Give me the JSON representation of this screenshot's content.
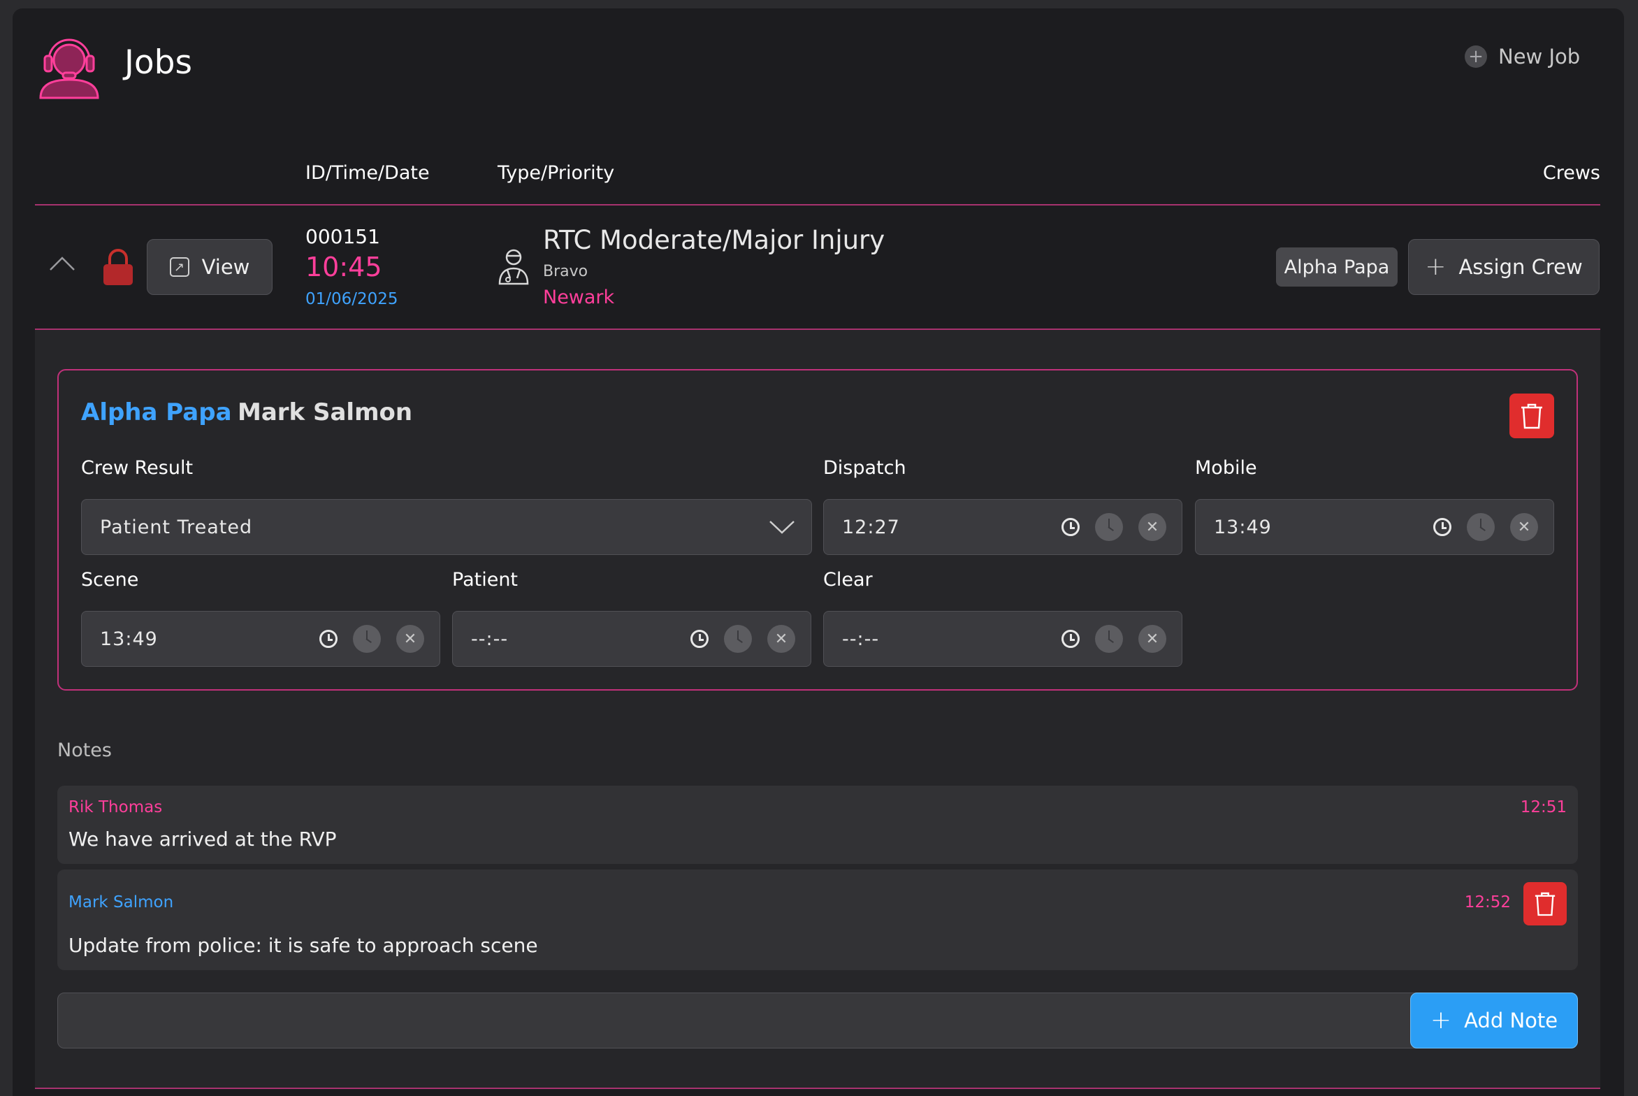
{
  "header": {
    "title": "Jobs",
    "new_job_label": "New Job"
  },
  "columns": {
    "id_time_date": "ID/Time/Date",
    "type_priority": "Type/Priority",
    "crews": "Crews"
  },
  "job": {
    "id": "000151",
    "time": "10:45",
    "date": "01/06/2025",
    "type": "RTC Moderate/Major Injury",
    "priority": "Bravo",
    "location": "Newark",
    "view_label": "View",
    "crew_chip": "Alpha Papa",
    "assign_crew_label": "Assign Crew"
  },
  "crew": {
    "name": "Alpha Papa",
    "member": "Mark Salmon",
    "fields": {
      "crew_result": {
        "label": "Crew Result",
        "value": "Patient Treated"
      },
      "dispatch": {
        "label": "Dispatch",
        "value": "12:27"
      },
      "mobile": {
        "label": "Mobile",
        "value": "13:49"
      },
      "scene": {
        "label": "Scene",
        "value": "13:49"
      },
      "patient": {
        "label": "Patient",
        "value": "--:--"
      },
      "clear": {
        "label": "Clear",
        "value": "--:--"
      }
    }
  },
  "notes": {
    "label": "Notes",
    "items": [
      {
        "author": "Rik Thomas",
        "time": "12:51",
        "text": "We have arrived at the RVP"
      },
      {
        "author": "Mark Salmon",
        "time": "12:52",
        "text": "Update from police: it is safe to approach scene"
      }
    ],
    "input_value": "",
    "add_label": "Add Note"
  },
  "colors": {
    "accent_pink": "#ff3f9b",
    "accent_blue": "#3fa3ff",
    "danger": "#e02d2d",
    "rule": "#a8326f"
  }
}
